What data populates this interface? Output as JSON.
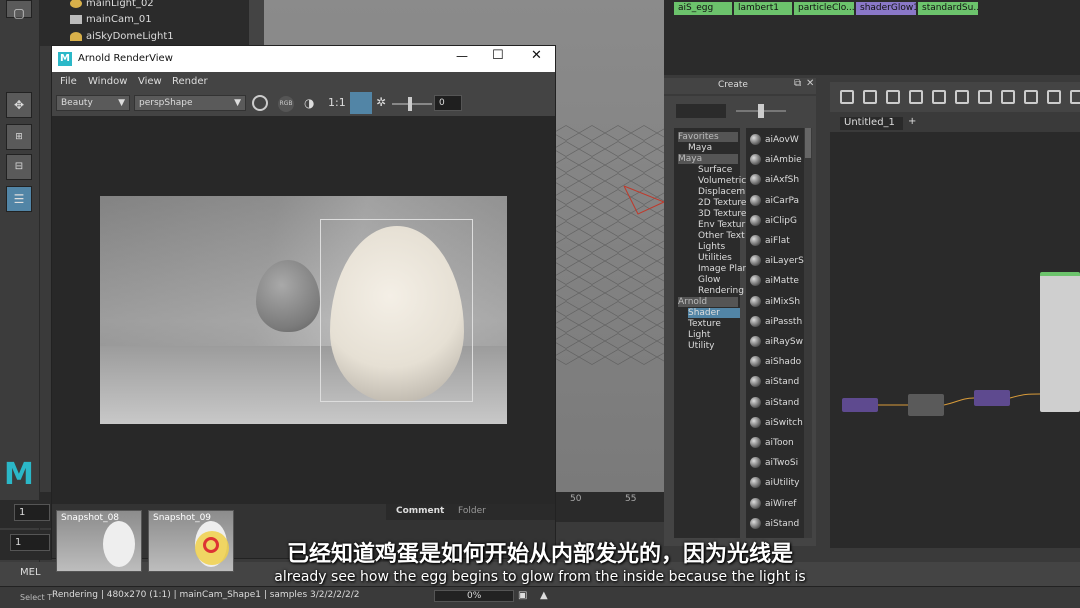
{
  "outliner": {
    "items": [
      {
        "label": "mainLight_02"
      },
      {
        "label": "mainCam_01"
      },
      {
        "label": "aiSkyDomeLight1"
      }
    ]
  },
  "timeline": {
    "start_frame": "1",
    "current_frame": "1",
    "ticks": [
      "50",
      "55"
    ]
  },
  "mel": {
    "label": "MEL",
    "select_hint": "Select T"
  },
  "renderview": {
    "title": "Arnold RenderView",
    "menus": [
      "File",
      "Window",
      "View",
      "Render"
    ],
    "aov": "Beauty",
    "camera": "perspShape",
    "ratio": "1:1",
    "exposure": "0",
    "snapshots": [
      {
        "label": "Snapshot_08"
      },
      {
        "label": "Snapshot_09"
      }
    ],
    "tabs": [
      "Comment",
      "Folder"
    ],
    "status": "Rendering | 480x270 (1:1) | mainCam_Shape1 | samples 3/2/2/2/2/2",
    "progress": "0%"
  },
  "hypershade": {
    "materials": [
      {
        "label": "aiS_egg",
        "color": "#6cc36c"
      },
      {
        "label": "lambert1",
        "color": "#6cc36c"
      },
      {
        "label": "particleClo...",
        "color": "#6cc36c"
      },
      {
        "label": "shaderGlow1",
        "color": "#8a78c8"
      },
      {
        "label": "standardSu...",
        "color": "#6cc36c"
      }
    ],
    "create_title": "Create",
    "tree": [
      {
        "label": "Favorites",
        "indent": 0
      },
      {
        "label": "Maya",
        "indent": 1
      },
      {
        "label": "Maya",
        "indent": 0
      },
      {
        "label": "Surface",
        "indent": 2
      },
      {
        "label": "Volumetric",
        "indent": 2
      },
      {
        "label": "Displacem",
        "indent": 2
      },
      {
        "label": "2D Texture",
        "indent": 2
      },
      {
        "label": "3D Texture",
        "indent": 2
      },
      {
        "label": "Env Textur",
        "indent": 2
      },
      {
        "label": "Other Text",
        "indent": 2
      },
      {
        "label": "Lights",
        "indent": 2
      },
      {
        "label": "Utilities",
        "indent": 2
      },
      {
        "label": "Image Plan",
        "indent": 2
      },
      {
        "label": "Glow",
        "indent": 2
      },
      {
        "label": "Rendering",
        "indent": 2
      },
      {
        "label": "Arnold",
        "indent": 0
      },
      {
        "label": "Shader",
        "indent": 1
      },
      {
        "label": "Texture",
        "indent": 1
      },
      {
        "label": "Light",
        "indent": 1
      },
      {
        "label": "Utility",
        "indent": 1
      }
    ],
    "nodes": [
      "aiAovW",
      "aiAmbie",
      "aiAxfSh",
      "aiCarPa",
      "aiClipG",
      "aiFlat",
      "aiLayerS",
      "aiMatte",
      "aiMixSh",
      "aiPassth",
      "aiRaySw",
      "aiShado",
      "aiStand",
      "aiStand",
      "aiSwitch",
      "aiToon",
      "aiTwoSi",
      "aiUtility",
      "aiWiref",
      "aiStand"
    ],
    "graph_tab": "Untitled_1",
    "graph_tab_add": "+"
  },
  "subtitles": {
    "zh": "已经知道鸡蛋是如何开始从内部发光的，因为光线是",
    "en": "already see how the egg begins to glow from the inside because the light is"
  },
  "colors": {
    "accent": "#2bb8c8",
    "selection": "#5285a6"
  }
}
